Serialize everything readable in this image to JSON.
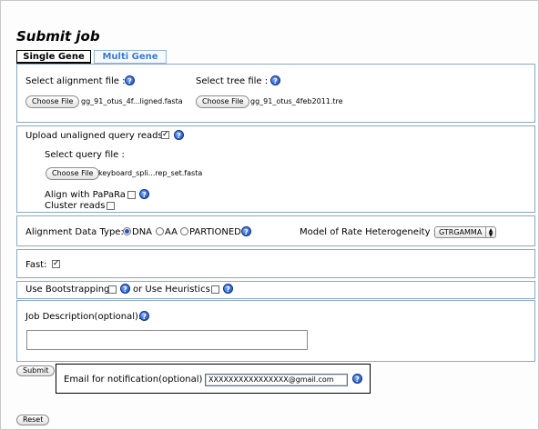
{
  "page": {
    "title": "Submit job"
  },
  "tabs": [
    {
      "label": "Single Gene",
      "active": true
    },
    {
      "label": "Multi Gene",
      "active": false
    }
  ],
  "alignment": {
    "label": "Select alignment file :",
    "button": "Choose File",
    "filename": "gg_91_otus_4f...ligned.fasta"
  },
  "tree": {
    "label": "Select tree file :",
    "button": "Choose File",
    "filename": "gg_91_otus_4feb2011.tre"
  },
  "query": {
    "upload_label": "Upload unaligned query reads:",
    "upload_checked": true,
    "select_label": "Select query file :",
    "button": "Choose File",
    "filename": "keyboard_spli...rep_set.fasta",
    "papara_label": "Align with PaPaRa",
    "cluster_label": "Cluster reads"
  },
  "datatype": {
    "label": "Alignment Data Type:",
    "options": [
      "DNA",
      "AA",
      "PARTIONED"
    ],
    "selected": "DNA"
  },
  "rate": {
    "label": "Model of Rate Heterogeneity :",
    "value": "GTRGAMMA"
  },
  "fast": {
    "label": "Fast:",
    "checked": true
  },
  "bootstrap": {
    "label": "Use Bootstrapping",
    "or_label": "or Use Heuristics"
  },
  "description": {
    "label": "Job Description(optional):",
    "value": ""
  },
  "submit": {
    "label": "Submit"
  },
  "email": {
    "label": "Email for notification(optional) :",
    "value": "XXXXXXXXXXXXXXXX@gmail.com"
  },
  "reset": {
    "label": "Reset"
  },
  "colors": {
    "help": "#1948b8",
    "section_border": "#8aa9c9",
    "tab_inactive": "#3a7bd5"
  }
}
